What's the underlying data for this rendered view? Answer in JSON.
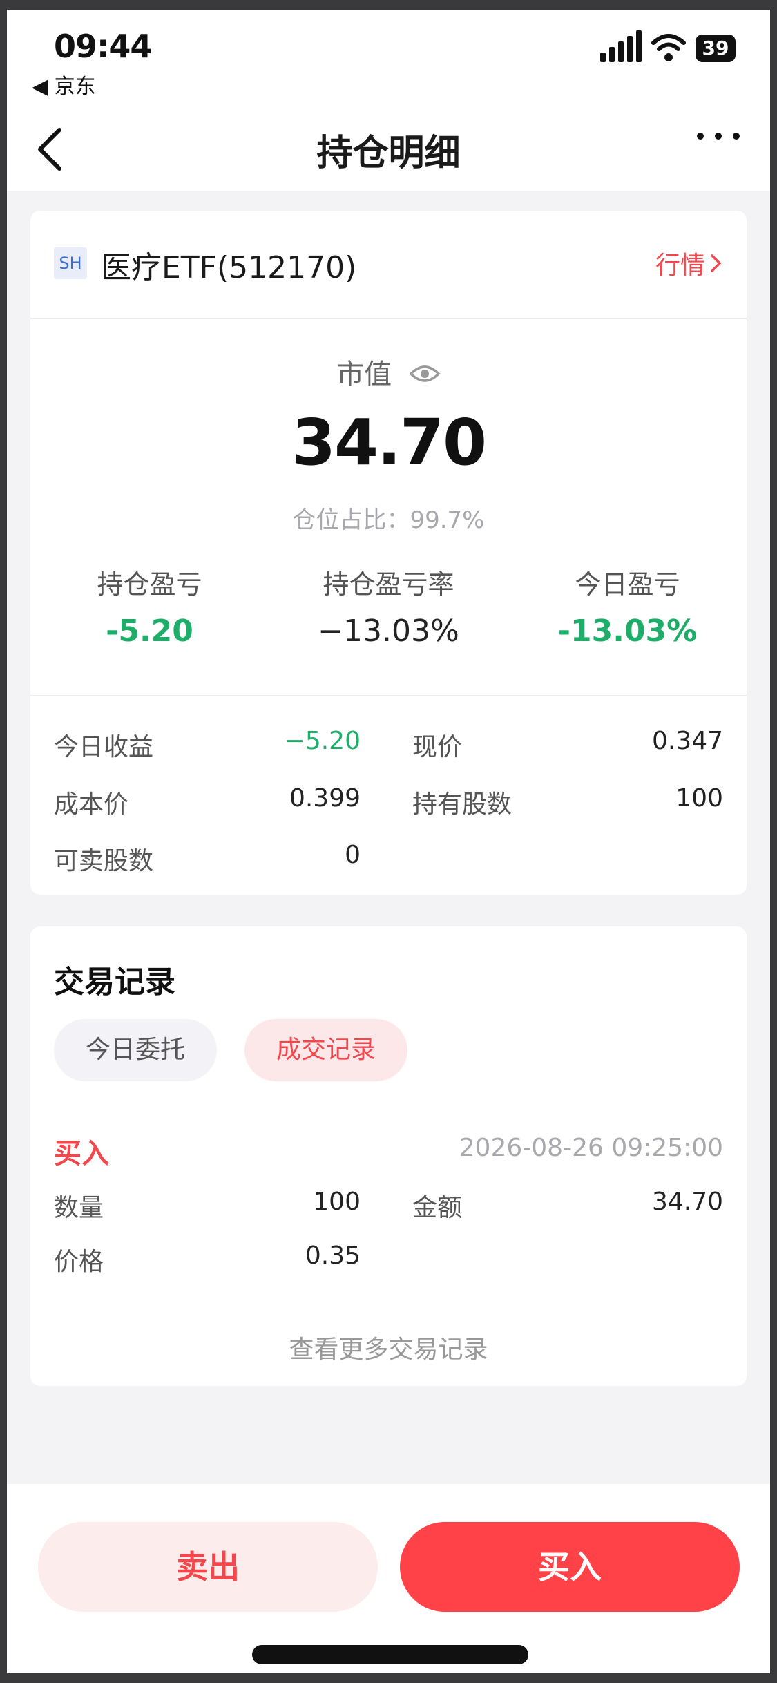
{
  "status_bar": {
    "time": "09:44",
    "back_app": "◀ 京东",
    "battery": "39"
  },
  "nav": {
    "title": "持仓明细"
  },
  "stock": {
    "market": "SH",
    "name": "医疗ETF(512170)",
    "quote_link": "行情"
  },
  "position": {
    "market_value_label": "市值",
    "market_value": "34.70",
    "ratio_text": "仓位占比：99.7%",
    "pl_items": [
      {
        "label": "持仓盈亏",
        "value": "-5.20"
      },
      {
        "label": "持仓盈亏率",
        "value": "−13.03%"
      },
      {
        "label": "今日盈亏",
        "value": "-13.03%"
      }
    ],
    "details": {
      "today_income_label": "今日收益",
      "today_income": "−5.20",
      "current_price_label": "现价",
      "current_price": "0.347",
      "cost_price_label": "成本价",
      "cost_price": "0.399",
      "shares_held_label": "持有股数",
      "shares_held": "100",
      "sellable_label": "可卖股数",
      "sellable": "0"
    }
  },
  "trades": {
    "title": "交易记录",
    "tabs": [
      "今日委托",
      "成交记录"
    ],
    "active_tab": 1,
    "record": {
      "side": "买入",
      "time": "2026-08-26 09:25:00",
      "qty_label": "数量",
      "qty": "100",
      "amount_label": "金额",
      "amount": "34.70",
      "price_label": "价格",
      "price": "0.35"
    },
    "more": "查看更多交易记录"
  },
  "actions": {
    "sell": "卖出",
    "buy": "买入"
  },
  "colors": {
    "accent_red": "#f2474d",
    "gain_green": "#1fae6a"
  },
  "icons": [
    "back-arrow-icon",
    "more-dots-icon",
    "eye-icon",
    "chevron-right-icon",
    "signal-icon",
    "wifi-icon",
    "battery-icon"
  ]
}
